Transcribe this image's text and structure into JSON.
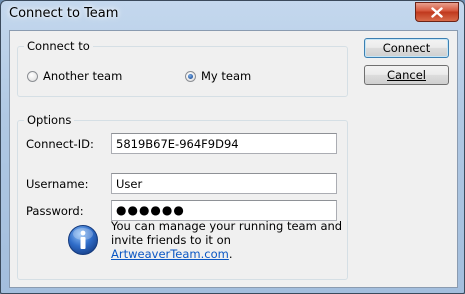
{
  "window": {
    "title": "Connect to Team"
  },
  "connect_to": {
    "title": "Connect to",
    "options": [
      {
        "label": "Another team",
        "checked": false
      },
      {
        "label": "My team",
        "checked": true
      }
    ]
  },
  "options": {
    "title": "Options",
    "connect_id_label": "Connect-ID:",
    "connect_id_value": "5819B67E-964F9D94",
    "username_label": "Username:",
    "username_value": "User",
    "password_label": "Password:",
    "password_value": "●●●●●●",
    "info_line1": "You can manage your running team and",
    "info_line2_prefix": "invite friends to it on ",
    "info_link": "ArtweaverTeam.com",
    "info_line2_suffix": "."
  },
  "buttons": {
    "connect": "Connect",
    "cancel": "Cancel"
  },
  "icons": {
    "close": "close-icon",
    "info": "info-icon"
  },
  "colors": {
    "accent": "#0b57c4",
    "close": "#c0381d"
  }
}
